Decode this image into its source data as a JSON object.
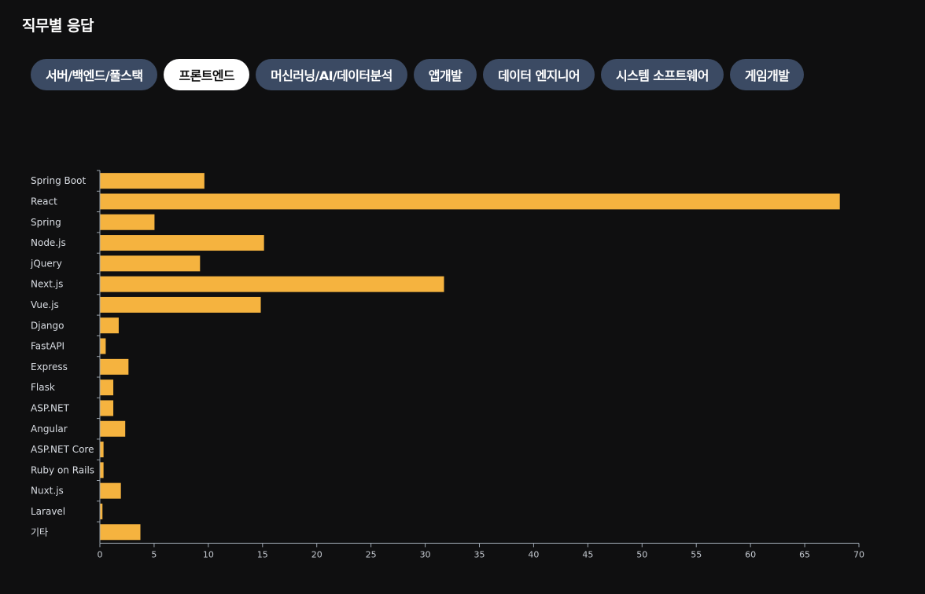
{
  "page": {
    "title": "직무별 응답"
  },
  "tabs": [
    {
      "label": "서버/백엔드/풀스택",
      "active": false
    },
    {
      "label": "프론트엔드",
      "active": true
    },
    {
      "label": "머신러닝/AI/데이터분석",
      "active": false
    },
    {
      "label": "앱개발",
      "active": false
    },
    {
      "label": "데이터 엔지니어",
      "active": false
    },
    {
      "label": "시스템 소프트웨어",
      "active": false
    },
    {
      "label": "게임개발",
      "active": false
    }
  ],
  "chart_data": {
    "type": "bar",
    "orientation": "horizontal",
    "categories": [
      "Spring Boot",
      "React",
      "Spring",
      "Node.js",
      "jQuery",
      "Next.js",
      "Vue.js",
      "Django",
      "FastAPI",
      "Express",
      "Flask",
      "ASP.NET",
      "Angular",
      "ASP.NET Core",
      "Ruby on Rails",
      "Nuxt.js",
      "Laravel",
      "기타"
    ],
    "values": [
      9.6,
      68.2,
      5.0,
      15.1,
      9.2,
      31.7,
      14.8,
      1.7,
      0.5,
      2.6,
      1.2,
      1.2,
      2.3,
      0.3,
      0.3,
      1.9,
      0.2,
      3.7
    ],
    "xlim": [
      0,
      70
    ],
    "xticks": [
      0,
      5,
      10,
      15,
      20,
      25,
      30,
      35,
      40,
      45,
      50,
      55,
      60,
      65,
      70
    ],
    "bar_color": "#f5b33f",
    "axis_color": "#9aa3ad",
    "grid": false,
    "title": "",
    "xlabel": "",
    "ylabel": ""
  }
}
